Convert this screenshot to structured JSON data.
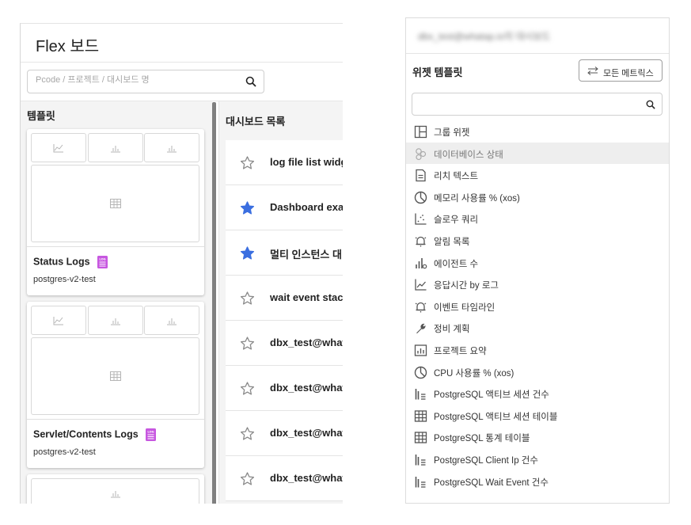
{
  "left_panel": {
    "title": "Flex 보드",
    "search_placeholder": "Pcode / 프로젝트 / 대시보드 명",
    "templates_header": "템플릿",
    "templates": [
      {
        "name": "Status Logs",
        "subtitle": "postgres-v2-test",
        "badge": "LOG"
      },
      {
        "name": "Servlet/Contents Logs",
        "subtitle": "postgres-v2-test",
        "badge": "LOG"
      }
    ],
    "dashboards_header": "대시보드 목록",
    "dashboards": [
      {
        "name": "log file list widg",
        "starred": false
      },
      {
        "name": "Dashboard exa",
        "starred": true
      },
      {
        "name": "멀티 인스턴스 대",
        "starred": true
      },
      {
        "name": "wait event stac",
        "starred": false
      },
      {
        "name": "dbx_test@what",
        "starred": false
      },
      {
        "name": "dbx_test@what",
        "starred": false
      },
      {
        "name": "dbx_test@what",
        "starred": false
      },
      {
        "name": "dbx_test@what",
        "starred": false
      }
    ]
  },
  "right_panel": {
    "email": "dbx_test@whatap.io의 대시보드",
    "title": "위젯 템플릿",
    "all_metrics_button": "모든 메트릭스",
    "search_value": "",
    "widgets": [
      {
        "label": "그룹 위젯",
        "icon": "group-widget-icon"
      },
      {
        "label": "데이터베이스 상태",
        "icon": "database-status-icon"
      },
      {
        "label": "리치 텍스트",
        "icon": "rich-text-icon"
      },
      {
        "label": "메모리 사용률 % (xos)",
        "icon": "pie-chart-icon"
      },
      {
        "label": "슬로우 쿼리",
        "icon": "scatter-chart-icon"
      },
      {
        "label": "알림 목록",
        "icon": "bell-icon"
      },
      {
        "label": "에이전트 수",
        "icon": "agent-count-icon"
      },
      {
        "label": "응답시간 by 로그",
        "icon": "line-chart-icon"
      },
      {
        "label": "이벤트 타임라인",
        "icon": "bell-icon"
      },
      {
        "label": "정비 계획",
        "icon": "wrench-icon"
      },
      {
        "label": "프로젝트 요약",
        "icon": "project-summary-icon"
      },
      {
        "label": "CPU 사용률 % (xos)",
        "icon": "pie-chart-icon"
      },
      {
        "label": "PostgreSQL 액티브 세션 건수",
        "icon": "bar-list-icon"
      },
      {
        "label": "PostgreSQL 액티브 세션 테이블",
        "icon": "table-icon"
      },
      {
        "label": "PostgreSQL 통계 테이블",
        "icon": "table-icon"
      },
      {
        "label": "PostgreSQL Client Ip 건수",
        "icon": "bar-list-icon"
      },
      {
        "label": "PostgreSQL Wait Event 건수",
        "icon": "bar-list-icon"
      }
    ]
  },
  "colors": {
    "star_active": "#3b6fe0",
    "star_inactive": "#8a8a8a",
    "log_badge": "#c757e0",
    "panel_bg": "#f4f4f4"
  }
}
